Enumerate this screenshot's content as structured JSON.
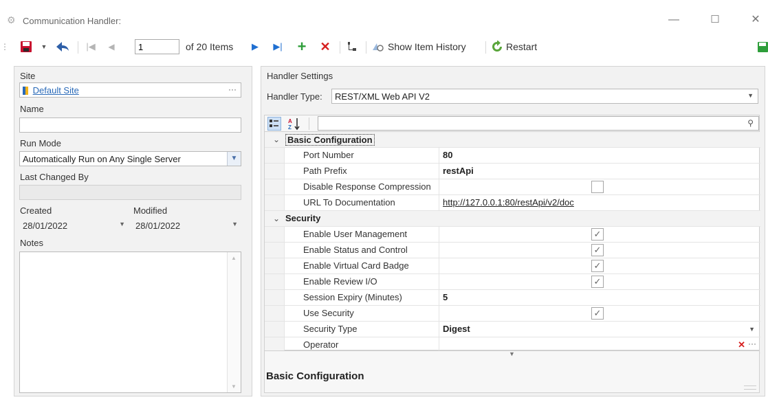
{
  "window": {
    "title": "Communication Handler:",
    "minimize": "—",
    "maximize": "☐",
    "close": "✕"
  },
  "toolbar": {
    "position_value": "1",
    "of_items": "of 20 Items",
    "show_history": "Show Item History",
    "restart": "Restart"
  },
  "left": {
    "site_label": "Site",
    "site_value": "Default Site",
    "name_label": "Name",
    "name_value": "",
    "run_mode_label": "Run Mode",
    "run_mode_value": "Automatically Run on Any Single Server",
    "last_changed_label": "Last Changed By",
    "last_changed_value": "",
    "created_label": "Created",
    "created_value": "28/01/2022",
    "modified_label": "Modified",
    "modified_value": "28/01/2022",
    "notes_label": "Notes"
  },
  "right": {
    "section_label": "Handler Settings",
    "handler_type_label": "Handler Type:",
    "handler_type_value": "REST/XML Web API V2",
    "search_value": "",
    "categories": [
      {
        "label": "Basic Configuration",
        "rows": [
          {
            "name": "Port Number",
            "value": "80",
            "kind": "text"
          },
          {
            "name": "Path Prefix",
            "value": "restApi",
            "kind": "text"
          },
          {
            "name": "Disable Response Compression",
            "checked": false,
            "kind": "check"
          },
          {
            "name": "URL To Documentation",
            "value": "http://127.0.0.1:80/restApi/v2/doc",
            "kind": "link"
          }
        ]
      },
      {
        "label": "Security",
        "rows": [
          {
            "name": "Enable User Management",
            "checked": true,
            "kind": "check"
          },
          {
            "name": "Enable Status and Control",
            "checked": true,
            "kind": "check"
          },
          {
            "name": "Enable Virtual Card Badge",
            "checked": true,
            "kind": "check"
          },
          {
            "name": "Enable Review I/O",
            "checked": true,
            "kind": "check"
          },
          {
            "name": "Session Expiry (Minutes)",
            "value": "5",
            "kind": "text"
          },
          {
            "name": "Use Security",
            "checked": true,
            "kind": "check"
          },
          {
            "name": "Security Type",
            "value": "Digest",
            "kind": "dropdown"
          },
          {
            "name": "Operator",
            "value": "",
            "kind": "operator"
          }
        ]
      }
    ],
    "description_title": "Basic Configuration"
  },
  "icons": {
    "save": "save-icon",
    "back": "back-arrow-icon",
    "first": "first-record-icon",
    "prev": "previous-record-icon",
    "next": "next-record-icon",
    "last": "last-record-icon",
    "add": "add-icon",
    "delete": "delete-icon",
    "tree": "tree-icon",
    "history": "history-icon",
    "restart": "restart-icon"
  },
  "colors": {
    "accent": "#2a6ab8",
    "save_red": "#c8102e",
    "add_green": "#2e9e3a",
    "delete_red": "#d61f1f",
    "restart_green": "#5aa63b"
  }
}
